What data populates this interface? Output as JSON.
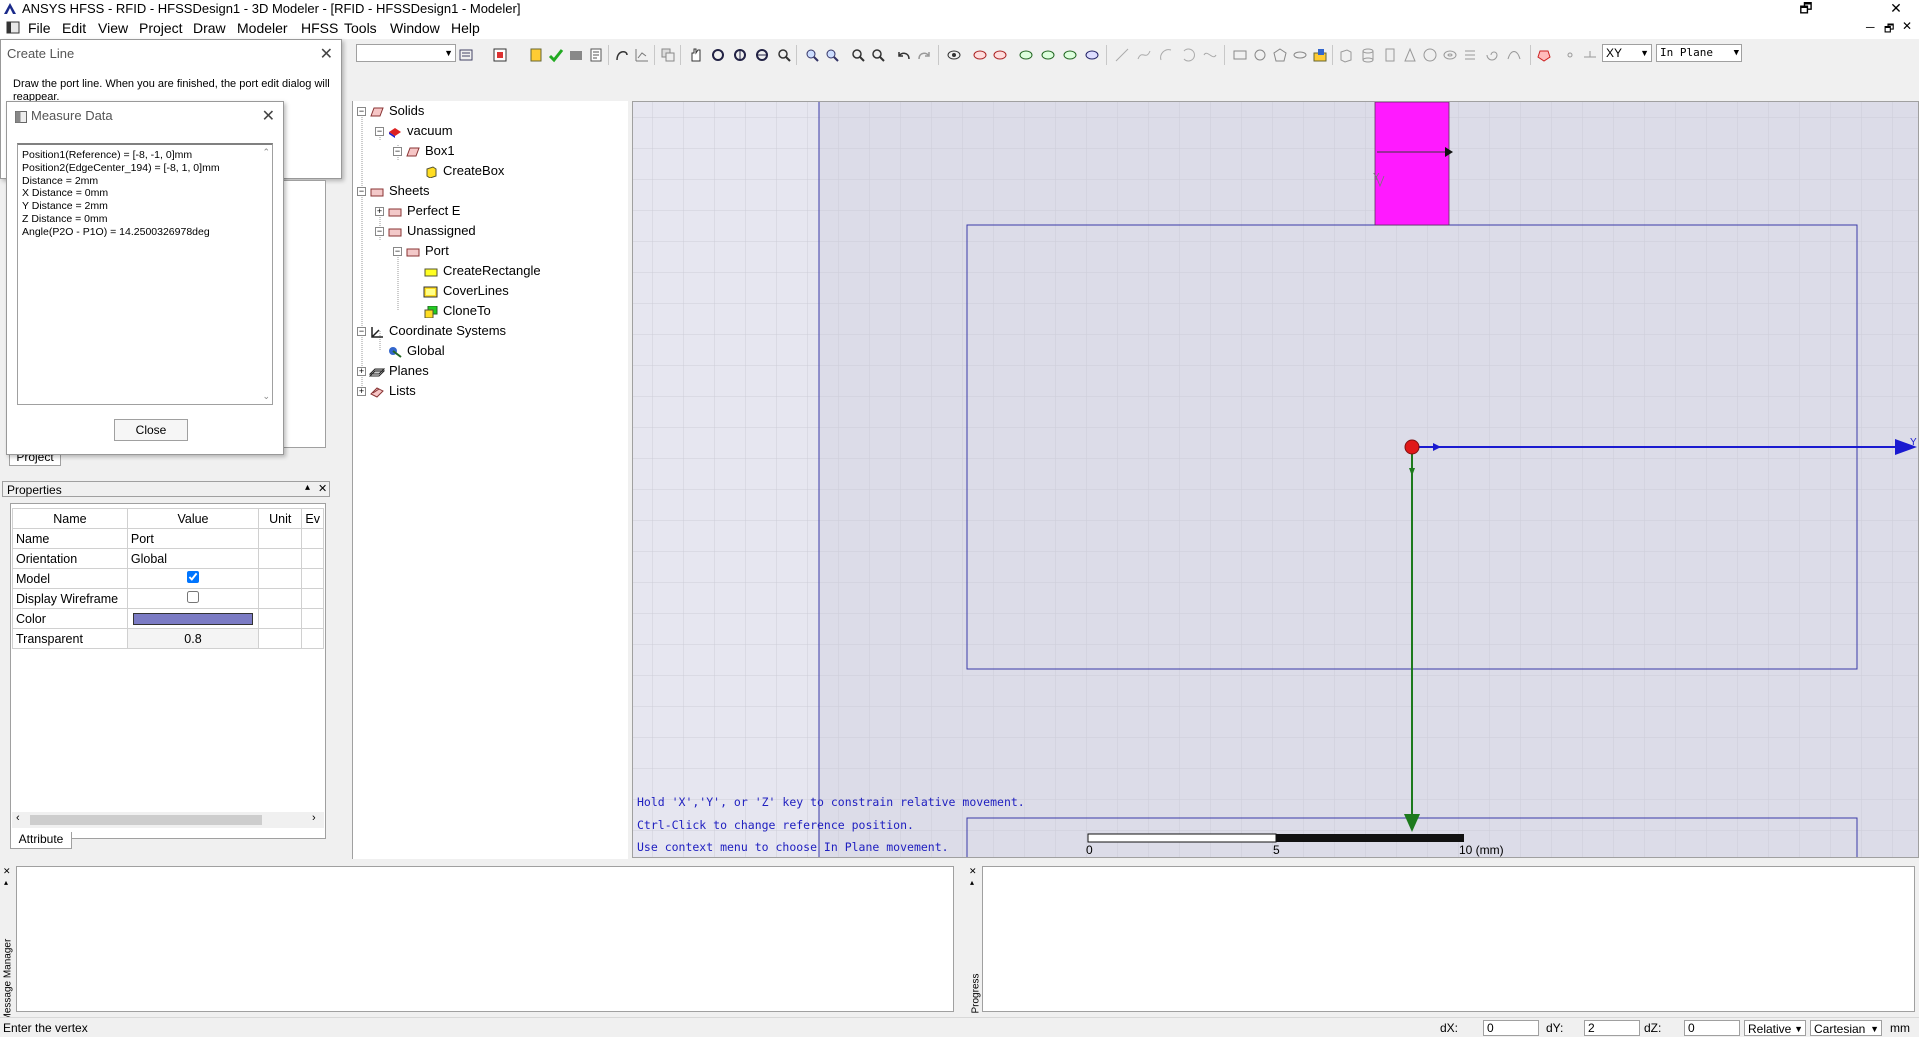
{
  "window": {
    "title": "ANSYS HFSS - RFID - HFSSDesign1 - 3D Modeler - [RFID - HFSSDesign1 - Modeler]"
  },
  "menu": [
    "File",
    "Edit",
    "View",
    "Project",
    "Draw",
    "Modeler",
    "HFSS",
    "Tools",
    "Window",
    "Help"
  ],
  "toolbar": {
    "plane_value": "XY",
    "movement_value": "In Plane"
  },
  "create_line": {
    "title": "Create Line",
    "message": "Draw the port line.  When you are finished, the port edit dialog will reappear."
  },
  "measure_data": {
    "title": "Measure Data",
    "lines": [
      "Position1(Reference) = [-8, -1, 0]mm",
      "Position2(EdgeCenter_194) = [-8, 1, 0]mm",
      "Distance = 2mm",
      "X Distance = 0mm",
      "Y Distance = 2mm",
      "Z Distance = 0mm",
      "Angle(P2O - P1O) = 14.2500326978deg"
    ],
    "close_label": "Close"
  },
  "project_tab": "Project",
  "tree": {
    "solids": "Solids",
    "vacuum": "vacuum",
    "box1": "Box1",
    "createbox": "CreateBox",
    "sheets": "Sheets",
    "perfect_e": "Perfect E",
    "unassigned": "Unassigned",
    "port": "Port",
    "createrectangle": "CreateRectangle",
    "coverlines": "CoverLines",
    "cloneto": "CloneTo",
    "coord_systems": "Coordinate Systems",
    "global": "Global",
    "planes": "Planes",
    "lists": "Lists"
  },
  "properties": {
    "title": "Properties",
    "headers": [
      "Name",
      "Value",
      "Unit",
      "Ev"
    ],
    "rows": [
      {
        "name": "Name",
        "value": "Port"
      },
      {
        "name": "Orientation",
        "value": "Global"
      },
      {
        "name": "Model",
        "checked": true
      },
      {
        "name": "Display Wireframe",
        "checked": false
      },
      {
        "name": "Color",
        "color": "#7b7bc4"
      },
      {
        "name": "Transparent",
        "value": "0.8"
      }
    ],
    "tab": "Attribute"
  },
  "viewport": {
    "hints": [
      "Hold 'X','Y', or 'Z' key to constrain relative movement.",
      "Ctrl-Click to change reference position.",
      "Use context menu to choose In Plane movement."
    ],
    "scale_labels": [
      "0",
      "5",
      "10 (mm)"
    ],
    "axis_y": "Y",
    "axis_y_top": "Y",
    "box_color": "#ff1aff"
  },
  "panes": {
    "message_manager": "Message Manager",
    "progress": "Progress"
  },
  "statusbar": {
    "prompt": "Enter the vertex",
    "dx_label": "dX:",
    "dx_value": "0",
    "dy_label": "dY:",
    "dy_value": "2",
    "dz_label": "dZ:",
    "dz_value": "0",
    "mode": "Relative",
    "coord": "Cartesian",
    "unit": "mm"
  }
}
